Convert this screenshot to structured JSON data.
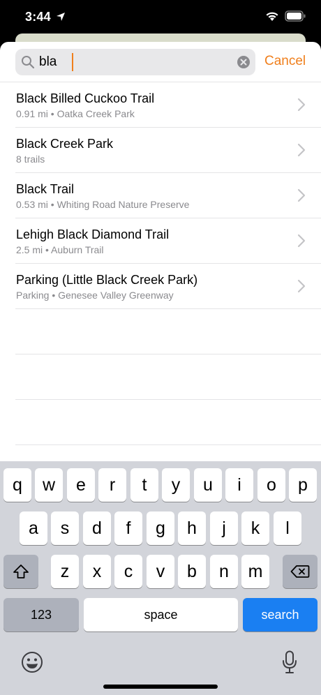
{
  "status": {
    "time": "3:44"
  },
  "search": {
    "query": "bla",
    "cancel_label": "Cancel",
    "accent_color": "#f07f1c"
  },
  "results": [
    {
      "title": "Black Billed Cuckoo Trail",
      "subtitle": "0.91 mi • Oatka Creek Park"
    },
    {
      "title": "Black Creek Park",
      "subtitle": "8 trails"
    },
    {
      "title": "Black Trail",
      "subtitle": "0.53 mi • Whiting Road Nature Preserve"
    },
    {
      "title": "Lehigh Black Diamond Trail",
      "subtitle": "2.5 mi • Auburn Trail"
    },
    {
      "title": "Parking (Little Black Creek Park)",
      "subtitle": "Parking • Genesee Valley Greenway"
    }
  ],
  "keyboard": {
    "row1": [
      "q",
      "w",
      "e",
      "r",
      "t",
      "y",
      "u",
      "i",
      "o",
      "p"
    ],
    "row2": [
      "a",
      "s",
      "d",
      "f",
      "g",
      "h",
      "j",
      "k",
      "l"
    ],
    "row3": [
      "z",
      "x",
      "c",
      "v",
      "b",
      "n",
      "m"
    ],
    "numbers_label": "123",
    "space_label": "space",
    "search_label": "search",
    "shift_icon": "shift-icon",
    "delete_icon": "delete-icon",
    "search_key_color": "#1a7ff2"
  }
}
